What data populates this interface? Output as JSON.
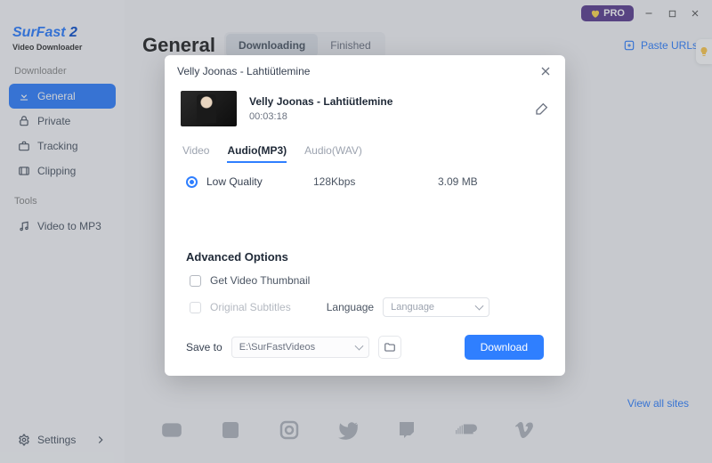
{
  "brand": {
    "name_a": "SurFast",
    "name_b": "2",
    "sub": "Video Downloader"
  },
  "topbar": {
    "pro": "PRO"
  },
  "sidebar": {
    "section_downloader": "Downloader",
    "section_tools": "Tools",
    "items": {
      "general": "General",
      "private": "Private",
      "tracking": "Tracking",
      "clipping": "Clipping",
      "video_to_mp3": "Video to MP3"
    },
    "settings": "Settings"
  },
  "header": {
    "title": "General",
    "tab_downloading": "Downloading",
    "tab_finished": "Finished",
    "paste_urls": "Paste URLs"
  },
  "footer": {
    "view_all": "View all sites"
  },
  "modal": {
    "head": "Velly Joonas - Lahtiütlemine",
    "title": "Velly Joonas - Lahtiütlemine",
    "duration": "00:03:18",
    "tabs": {
      "video": "Video",
      "audio_mp3": "Audio(MP3)",
      "audio_wav": "Audio(WAV)"
    },
    "quality": {
      "label": "Low Quality",
      "bitrate": "128Kbps",
      "size": "3.09 MB"
    },
    "advanced": {
      "header": "Advanced Options",
      "thumbnail": "Get Video Thumbnail",
      "subtitles": "Original Subtitles",
      "language_label": "Language",
      "language_placeholder": "Language"
    },
    "save": {
      "label": "Save to",
      "path": "E:\\SurFastVideos"
    },
    "download": "Download"
  }
}
